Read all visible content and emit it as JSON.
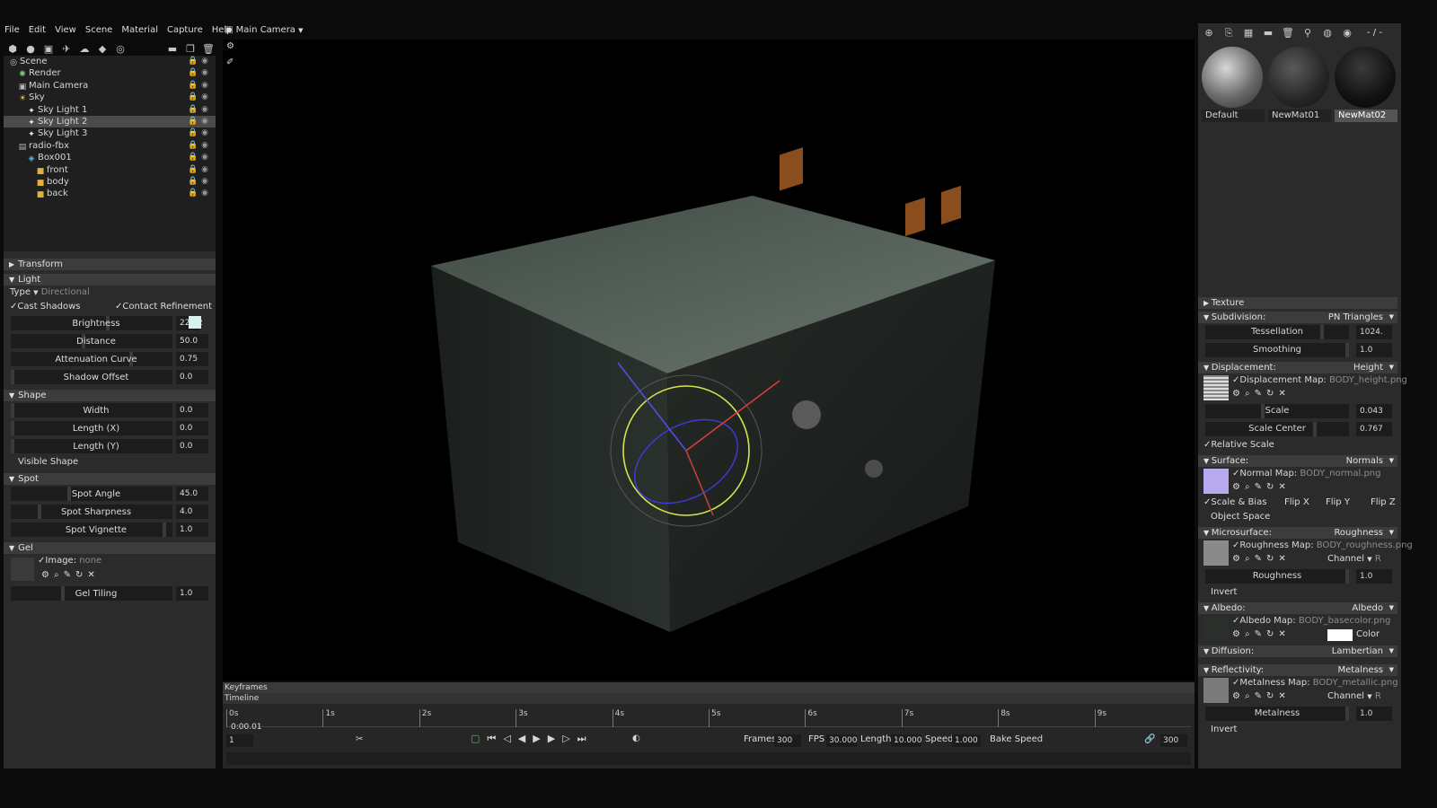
{
  "menu": [
    "File",
    "Edit",
    "View",
    "Scene",
    "Material",
    "Capture",
    "Help"
  ],
  "viewport": {
    "camera_label": "Main Camera"
  },
  "outliner": [
    {
      "label": "Scene",
      "indent": 0,
      "icon": "scene-icon",
      "sel": false
    },
    {
      "label": "Render",
      "indent": 1,
      "icon": "render-icon",
      "sel": false
    },
    {
      "label": "Main Camera",
      "indent": 1,
      "icon": "camera-icon",
      "sel": false
    },
    {
      "label": "Sky",
      "indent": 1,
      "icon": "sky-icon",
      "sel": false
    },
    {
      "label": "Sky Light 1",
      "indent": 2,
      "icon": "light-icon",
      "sel": false
    },
    {
      "label": "Sky Light 2",
      "indent": 2,
      "icon": "light-icon",
      "sel": true
    },
    {
      "label": "Sky Light 3",
      "indent": 2,
      "icon": "light-icon",
      "sel": false
    },
    {
      "label": "radio-fbx",
      "indent": 1,
      "icon": "mesh-icon",
      "sel": false
    },
    {
      "label": "Box001",
      "indent": 2,
      "icon": "box-icon",
      "sel": false
    },
    {
      "label": "front",
      "indent": 3,
      "icon": "material-icon",
      "sel": false
    },
    {
      "label": "body",
      "indent": 3,
      "icon": "material-icon",
      "sel": false
    },
    {
      "label": "back",
      "indent": 3,
      "icon": "material-icon",
      "sel": false
    }
  ],
  "left_panel": {
    "transform": "Transform",
    "light": "Light",
    "type_label": "Type",
    "type_value": "Directional",
    "cast_shadows": "Cast Shadows",
    "contact_refinement": "Contact Refinement",
    "brightness": {
      "label": "Brightness",
      "value": "22.02",
      "fill": 0.6
    },
    "distance": {
      "label": "Distance",
      "value": "50.0",
      "fill": 0.45
    },
    "attenuation": {
      "label": "Attenuation Curve",
      "value": "0.75",
      "fill": 0.75
    },
    "shadow_offset": {
      "label": "Shadow Offset",
      "value": "0.0",
      "fill": 0.0
    },
    "shape": "Shape",
    "width": {
      "label": "Width",
      "value": "0.0",
      "fill": 0.0
    },
    "length_x": {
      "label": "Length (X)",
      "value": "0.0",
      "fill": 0.0
    },
    "length_y": {
      "label": "Length (Y)",
      "value": "0.0",
      "fill": 0.0
    },
    "visible_shape": "Visible Shape",
    "spot": "Spot",
    "spot_angle": {
      "label": "Spot Angle",
      "value": "45.0",
      "fill": 0.36
    },
    "spot_sharpness": {
      "label": "Spot Sharpness",
      "value": "4.0",
      "fill": 0.17
    },
    "spot_vignette": {
      "label": "Spot Vignette",
      "value": "1.0",
      "fill": 0.96
    },
    "gel": "Gel",
    "image_label": "Image:",
    "image_value": "none",
    "gel_tiling": {
      "label": "Gel Tiling",
      "value": "1.0",
      "fill": 0.32
    }
  },
  "materials": [
    {
      "name": "Default",
      "selected": false
    },
    {
      "name": "NewMat01",
      "selected": false
    },
    {
      "name": "NewMat02",
      "selected": true
    }
  ],
  "right_toolbar_text": "- / -",
  "right_panel": {
    "texture": "Texture",
    "subdivision": {
      "label": "Subdivision:",
      "mode": "PN Triangles"
    },
    "tessellation": {
      "label": "Tessellation",
      "value": "1024.",
      "fill": 0.82
    },
    "smoothing": {
      "label": "Smoothing",
      "value": "1.0",
      "fill": 1.0
    },
    "displacement": {
      "label": "Displacement:",
      "mode": "Height"
    },
    "displacement_map": {
      "label": "Displacement Map:",
      "file": "BODY_height.png"
    },
    "scale": {
      "label": "Scale",
      "value": "0.043",
      "fill": 0.4
    },
    "scale_center": {
      "label": "Scale Center",
      "value": "0.767",
      "fill": 0.77
    },
    "relative_scale": "Relative Scale",
    "surface": {
      "label": "Surface:",
      "mode": "Normals"
    },
    "normal_map": {
      "label": "Normal Map:",
      "file": "BODY_normal.png"
    },
    "scale_bias": "Scale & Bias",
    "flip_x": "Flip X",
    "flip_y": "Flip Y",
    "flip_z": "Flip Z",
    "object_space": "Object Space",
    "microsurface": {
      "label": "Microsurface:",
      "mode": "Roughness"
    },
    "roughness_map": {
      "label": "Roughness Map:",
      "file": "BODY_roughness.png"
    },
    "channel_label": "Channel",
    "channel_r": "R",
    "roughness": {
      "label": "Roughness",
      "value": "1.0",
      "fill": 1.0
    },
    "invert": "Invert",
    "albedo": {
      "label": "Albedo:",
      "mode": "Albedo"
    },
    "albedo_map": {
      "label": "Albedo Map:",
      "file": "BODY_basecolor.png"
    },
    "color_label": "Color",
    "diffusion": {
      "label": "Diffusion:",
      "mode": "Lambertian"
    },
    "reflectivity": {
      "label": "Reflectivity:",
      "mode": "Metalness"
    },
    "metalness_map": {
      "label": "Metalness Map:",
      "file": "BODY_metallic.png"
    },
    "metalness": {
      "label": "Metalness",
      "value": "1.0",
      "fill": 1.0
    },
    "invert2": "Invert"
  },
  "timeline": {
    "keyframes": "Keyframes",
    "timeline": "Timeline",
    "ticks": [
      "0s",
      "1s",
      "2s",
      "3s",
      "4s",
      "5s",
      "6s",
      "7s",
      "8s",
      "9s"
    ],
    "current_time": "0:00.01",
    "frame_field": "1",
    "frames_label": "Frames",
    "frames_value": "300",
    "fps_label": "FPS",
    "fps_value": "30.000",
    "length_label": "Length",
    "length_value": "10.000",
    "speed_label": "Speed",
    "speed_value": "1.000",
    "bake_speed": "Bake Speed",
    "end_frame": "300"
  },
  "colors": {
    "panel": "#2b2b2b",
    "accent_light": "#d8f0ee",
    "normal_swatch": "#b9a9ee",
    "albedo_swatch": "#ffffff"
  }
}
